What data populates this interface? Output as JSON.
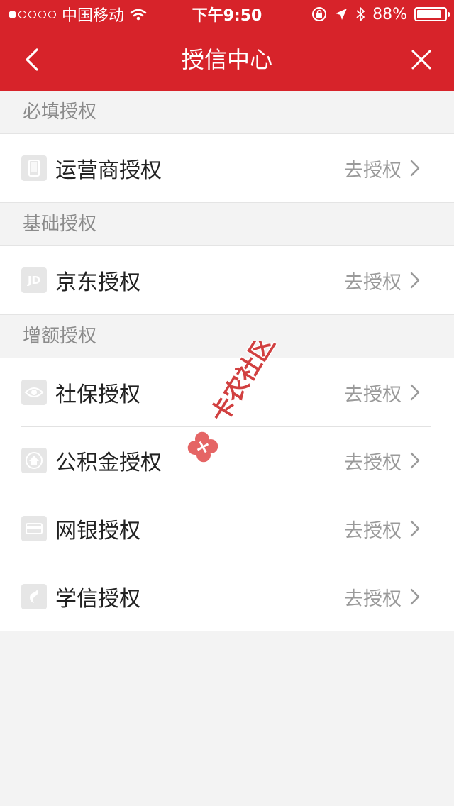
{
  "status_bar": {
    "carrier": "中国移动",
    "time": "下午9:50",
    "battery": "88%",
    "battery_level": 0.88,
    "signal_bars_filled": 1,
    "signal_bars_total": 5
  },
  "nav": {
    "title": "授信中心",
    "back_icon": "chevron-left-icon",
    "close_icon": "close-icon"
  },
  "sections": [
    {
      "header": "必填授权",
      "items": [
        {
          "label": "运营商授权",
          "icon": "phone-icon",
          "action": "去授权"
        }
      ]
    },
    {
      "header": "基础授权",
      "items": [
        {
          "label": "京东授权",
          "icon": "jd-logo-icon",
          "icon_text": "JD",
          "action": "去授权"
        }
      ]
    },
    {
      "header": "增额授权",
      "items": [
        {
          "label": "社保授权",
          "icon": "eye-icon",
          "action": "去授权"
        },
        {
          "label": "公积金授权",
          "icon": "house-fund-icon",
          "action": "去授权"
        },
        {
          "label": "网银授权",
          "icon": "bank-card-icon",
          "action": "去授权"
        },
        {
          "label": "学信授权",
          "icon": "education-icon",
          "action": "去授权"
        }
      ]
    }
  ],
  "watermark": {
    "text": "卡农社区"
  },
  "colors": {
    "primary_red": "#d7232a",
    "background": "#f3f3f3",
    "row_background": "#ffffff",
    "secondary_text": "#9a9a9a"
  }
}
